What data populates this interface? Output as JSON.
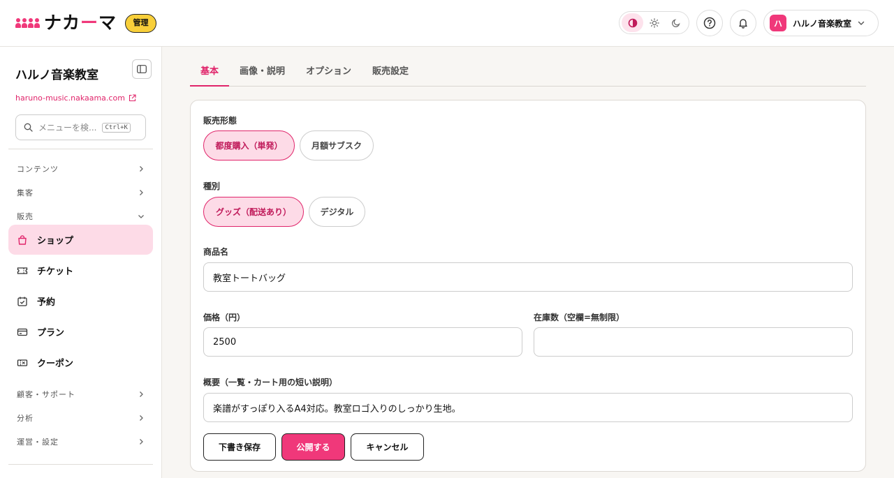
{
  "header": {
    "logo_text_a": "ナカ",
    "logo_text_accent": "ー",
    "logo_text_b": "マ",
    "admin_badge": "管理",
    "user": {
      "avatar_letter": "ハ",
      "name": "ハルノ音楽教室"
    }
  },
  "sidebar": {
    "site_title": "ハルノ音楽教室",
    "site_url": "haruno-music.nakaama.com",
    "search_placeholder": "メニューを検...",
    "search_shortcut": "Ctrl+K",
    "groups": {
      "contents": "コンテンツ",
      "marketing": "集客",
      "sales": "販売",
      "customers": "顧客・サポート",
      "analytics": "分析",
      "settings": "運営・設定"
    },
    "items": {
      "shop": "ショップ",
      "ticket": "チケット",
      "reservation": "予約",
      "plan": "プラン",
      "coupon": "クーポン"
    }
  },
  "main": {
    "tabs": [
      "基本",
      "画像・説明",
      "オプション",
      "販売設定"
    ],
    "form": {
      "sale_type_label": "販売形態",
      "sale_type_options": [
        "都度購入（単発）",
        "月額サブスク"
      ],
      "kind_label": "種別",
      "kind_options": [
        "グッズ（配送あり）",
        "デジタル"
      ],
      "product_name_label": "商品名",
      "product_name_value": "教室トートバッグ",
      "price_label": "価格（円）",
      "price_value": "2500",
      "stock_label": "在庫数（空欄=無制限）",
      "stock_value": "",
      "summary_label": "概要（一覧・カート用の短い説明）",
      "summary_value": "楽譜がすっぽり入るA4対応。教室ロゴ入りのしっかり生地。"
    },
    "buttons": {
      "draft": "下書き保存",
      "publish": "公開する",
      "cancel": "キャンセル"
    }
  },
  "colors": {
    "accent": "#f0387a",
    "badge": "#f8cf3a"
  }
}
